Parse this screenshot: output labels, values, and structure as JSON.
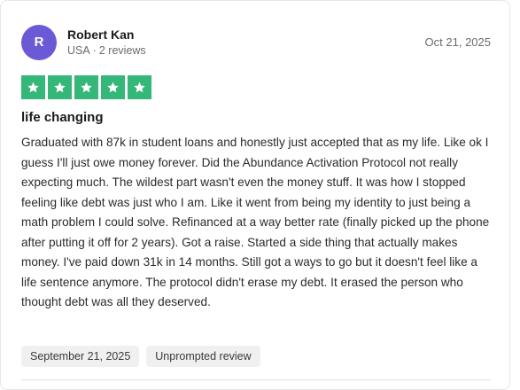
{
  "review": {
    "reviewer": {
      "initial": "R",
      "name": "Robert Kan",
      "country": "USA",
      "review_count": "2 reviews",
      "avatar_color": "#6a5ad6"
    },
    "date": "Oct 21, 2025",
    "rating": {
      "stars": 5,
      "max": 5,
      "color": "#34b778"
    },
    "title": "life changing",
    "text": "Graduated with 87k in student loans and honestly just accepted that as my life. Like ok I guess I'll just owe money forever. Did the Abundance Activation Protocol not really expecting much. The wildest part wasn't even the money stuff. It was how I stopped feeling like debt was just who I am. Like it went from being my identity to just being a math problem I could solve. Refinanced at a way better rate (finally picked up the phone after putting it off for 2 years). Got a raise. Started a side thing that actually makes money. I've paid down 31k in 14 months. Still got a ways to go but it doesn't feel like a life sentence anymore. The protocol didn't erase my debt. It erased the person who thought debt was all they deserved.",
    "tags": {
      "experience_date": "September 21, 2025",
      "review_type": "Unprompted review"
    }
  }
}
